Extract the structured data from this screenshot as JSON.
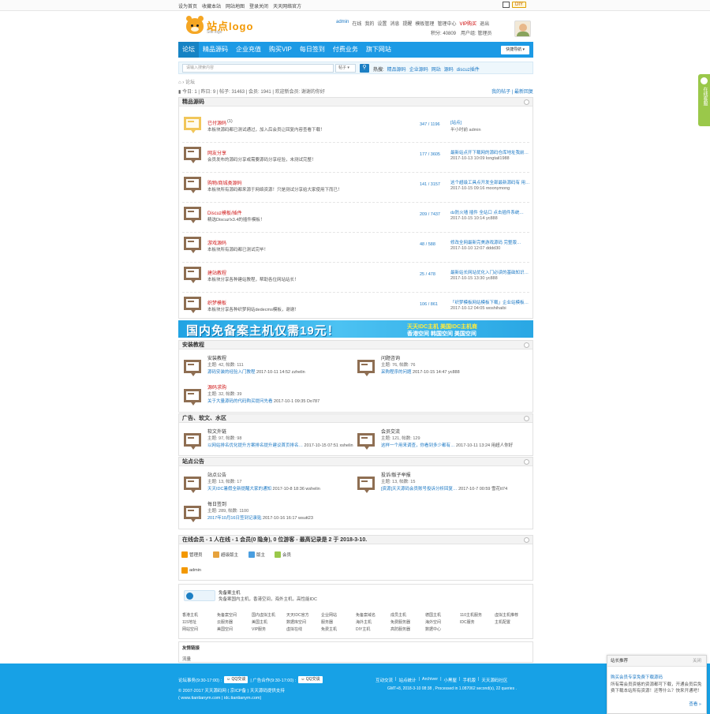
{
  "topbar": {
    "links": [
      "设为首页",
      "收藏本站",
      "网站地图",
      "登录关闭",
      "天天网络官方"
    ],
    "diy": "DIY"
  },
  "header": {
    "logo_name": "站点logo",
    "logo_sub": "Site logo",
    "user": [
      "admin",
      "在线",
      "我的",
      "设置",
      "消息",
      "提醒",
      "模板管理",
      "管理中心",
      "VIP购买",
      "退出"
    ],
    "user2": [
      "积分: 40809",
      "用户组: 管理员"
    ]
  },
  "nav": {
    "items": [
      "论坛",
      "精品源码",
      "企业充值",
      "购买VIP",
      "每日签到",
      "付费业务",
      "旗下网站"
    ],
    "quick": "快捷导航"
  },
  "search": {
    "placeholder": "请输入搜索内容",
    "type": "帖子",
    "hot_label": "热搜:",
    "hot": [
      "精品源码",
      "企业源码",
      "网站",
      "源码",
      "discuz插件"
    ]
  },
  "crumb": {
    "home": "⌂",
    "sep": "›",
    "current": "论坛"
  },
  "stats": {
    "text": "今日: 1 | 昨日: 9 | 帖子: 31463 | 会员: 1941 | 欢迎新会员: 谢谢的你好",
    "right": "我的帖子 | 最新回复"
  },
  "cat1": {
    "title": "精品源码",
    "forums": [
      {
        "name": "已付源码",
        "count_suffix": "(1)",
        "desc": "本板块源码都已测试通过，加入后会员让回复内容查看下载！",
        "count": "347 / 1196",
        "last1": "[站点]",
        "last2": "半小时前 admin",
        "alt": true
      },
      {
        "name": "网友分享",
        "count_suffix": "",
        "desc": "会员发布的源码分享或需要源码分享经验，未测试完整！",
        "count": "177 / 3605",
        "last1": "最新站点开下载网的源码仓库地址我前…",
        "last2": "2017-10-13 10:09 longtail1988",
        "alt": false
      },
      {
        "name": "购物/商城类源码",
        "count_suffix": "",
        "desc": "本板块所有源码都来源于网络资源！只是测试分享给大家使用下而已！",
        "count": "141 / 3157",
        "last1": "这个超级工具点开发全部最新源码有 用…",
        "last2": "2017-10-15 09:16 moonymong",
        "alt": false
      },
      {
        "name": "Discuz模板/插件",
        "count_suffix": "",
        "desc": "精选Discuz!x3.4的插件模板！",
        "count": "209 / 7437",
        "last1": "dz防火墙 插件 全站口 点击插件系统…",
        "last2": "2017-10-15 10:14 yc888",
        "alt": false
      },
      {
        "name": "游戏源码",
        "count_suffix": "",
        "desc": "本板块所有源码都已测试完毕！",
        "count": "48 / 588",
        "last1": "修改全网最新完美游戏源码 完整版…",
        "last2": "2017-10-10 12:07 dddd30",
        "alt": false
      },
      {
        "name": "建站教程",
        "count_suffix": "",
        "desc": "本板块分享各种建站教程，帮助各位网站站长！",
        "count": "25 / 478",
        "last1": "最新站长网站优化入门必读的基础知识…",
        "last2": "2017-10-15 13:30 yc888",
        "alt": false
      },
      {
        "name": "织梦模板",
        "count_suffix": "",
        "desc": "本板块分享各种织梦网站dedecms模板，谢谢！",
        "count": "106 / 861",
        "last1": "「织梦模板网站模板下载」企业站模板…",
        "last2": "2017-10-12 04:05 woshihaibi",
        "alt": false
      }
    ]
  },
  "banner": {
    "big": "国内免备案主机仅需19元！",
    "s1": "天天IDC主机 美国IDC主机商",
    "s2": "香港空间 韩国空间 美国空间"
  },
  "cat2": {
    "title": "安装教程",
    "cells": [
      {
        "name": "安装教程",
        "red": false,
        "sub": "主题: 42, 帖数: 111",
        "last_link": "源码安装的经验入门教程",
        "last_meta": "2017-10-11 14:52 zzhelin"
      },
      {
        "name": "问题咨询",
        "red": false,
        "sub": "主题: 76, 帖数: 76",
        "last_link": "采购程序的问题",
        "last_meta": "2017-10-15 14:47 yc888"
      },
      {
        "name": "源码求购",
        "red": true,
        "sub": "主题: 32, 帖数: 39",
        "last_link": "关于大量源码的代码购买提问先看",
        "last_meta": "2017-10-1 09:35 Do787"
      }
    ]
  },
  "cat3": {
    "title": "广告、软文、水区",
    "cells": [
      {
        "name": "软文外链",
        "red": false,
        "sub": "主题: 97, 帖数: 98",
        "last_link": "以网站排名优化提升方案排名提升建议首页排名…",
        "last_meta": "2017-10-15 07:51 xshelin"
      },
      {
        "name": "会员交流",
        "red": false,
        "sub": "主题: 121, 帖数: 129",
        "last_link": "这样一个用来调查，你看到多少都有…",
        "last_meta": "2017-10-11 13:24 用超人你好"
      }
    ]
  },
  "cat4": {
    "title": "站点公告",
    "cells": [
      {
        "name": "站点公告",
        "red": false,
        "sub": "主题: 13, 帖数: 17",
        "last_link": "天天IDC暑假全新提醒大家的通知",
        "last_meta": "2017-10-8 18:36 wshelin"
      },
      {
        "name": "投诉/版子举报",
        "red": false,
        "sub": "主题: 13, 帖数: 15",
        "last_link": "[资源]天天源码会员账号投诉分析回复…",
        "last_meta": "2017-10-7 00:59 雪花tt74"
      },
      {
        "name": "每日签到",
        "red": false,
        "sub": "主题: 289, 帖数: 1100",
        "last_link": "2017年10月16日签到记录贴",
        "last_meta": "2017-10-16 16:17 wsutt23"
      }
    ]
  },
  "online": {
    "title": "在线会员 - 1 人在线 - 1 会员(0 隐身), 0 位游客 - 最高记录是 2 于 2018-3-10.",
    "legend": [
      "管理员",
      "超级版主",
      "版主",
      "会员"
    ],
    "legend_colors": [
      "#f39800",
      "#e6a23c",
      "#4a9ee0",
      "#9ac84a"
    ],
    "user": "admin"
  },
  "partner": {
    "title": "免备案主机",
    "desc": "免备案国内主机，香港空间，海外主机，高性能IDC",
    "links": [
      "香港主机",
      "免备案空间",
      "国内虚拟主机",
      "天天IDC官方",
      "企业网站",
      "免备案域名",
      "成员主机",
      "德国主机",
      "110主机服务",
      "虚拟主机推荐",
      "115地址",
      "云服务器",
      "美国主机",
      "数据库空间",
      "服务器",
      "海外主机",
      "免费服务器",
      "海外空间",
      "IDC服务",
      "主机配置",
      "网站空间",
      "美国空间",
      "VIP服务",
      "虚拟在线",
      "免费主机",
      "DIY主机",
      "高防服务器",
      "数据中心"
    ]
  },
  "friend": {
    "title": "友情链接",
    "value": "流量"
  },
  "footer": {
    "qq1": "QQ交谈",
    "qq2": "QQ交谈",
    "l1a": "论坛事务(9:30-17:00) :",
    "l1b": "| 广告合作(9:30-17:00) :",
    "l2": "© 2007-2017 天天源码网 ( 京ICP备 ) 天天源码提供支持",
    "l3": "( www.tiantianym.com | idc.tiantianym.com)",
    "right_links": [
      "互动交流",
      "站点统计",
      "Archiver",
      "小黑屋",
      "手机版",
      "天天源码社区"
    ],
    "right2": "GMT+8, 2018-3-10 08:38 , Processed in 1.087062 second(s), 22 queries ."
  },
  "side": {
    "text": "在线客服"
  },
  "popup": {
    "title": "站长推荐",
    "close": "关闭",
    "head": "购买会员专享免费下载源码",
    "body": "所有需会员资格的资源都可下载，开通会员后免费下载本站所有资源！还等什么？快来开通吧！",
    "more": "查看 »"
  }
}
